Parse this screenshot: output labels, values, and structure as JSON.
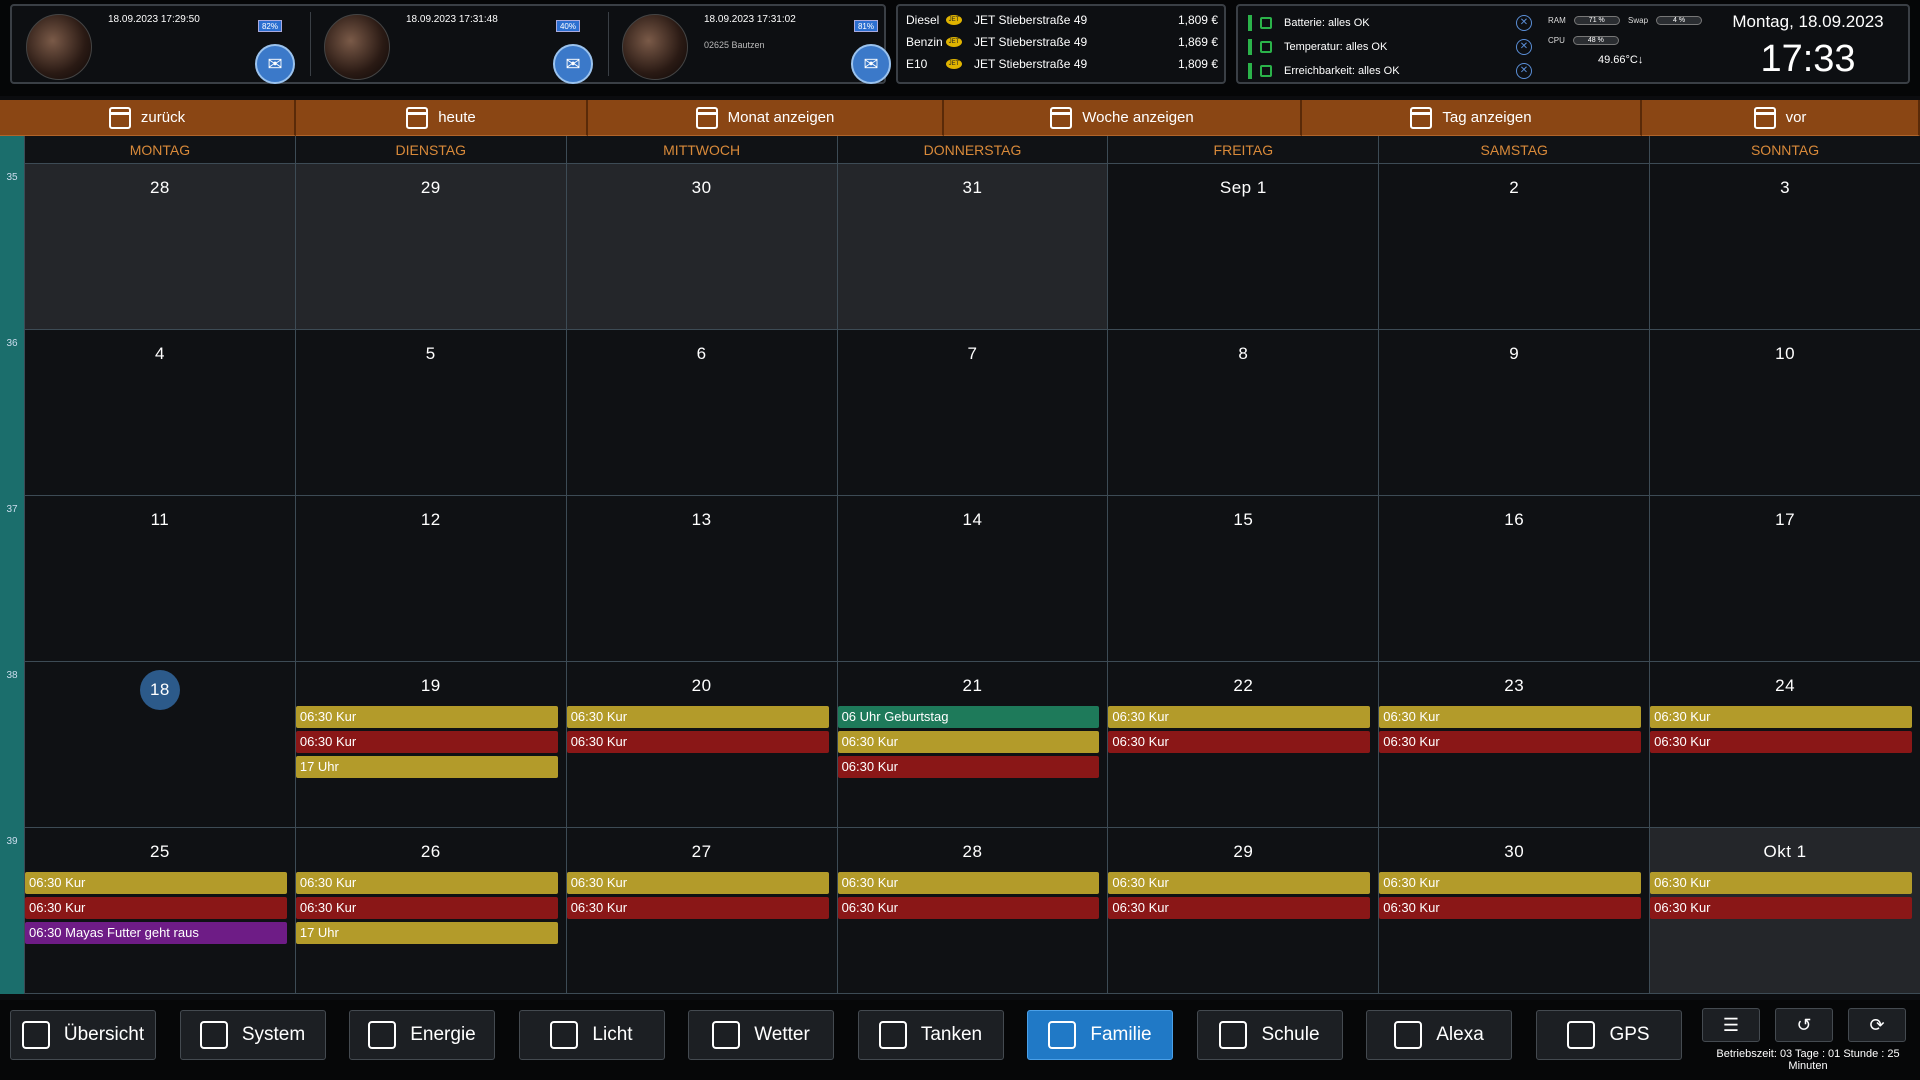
{
  "contacts": [
    {
      "timestamp": "18.09.2023 17:29:50",
      "line1": "",
      "line2": "",
      "battery": "82%"
    },
    {
      "timestamp": "18.09.2023 17:31:48",
      "line1": "",
      "line2": "",
      "battery": "40%"
    },
    {
      "timestamp": "18.09.2023 17:31:02",
      "line1": "",
      "line2": "02625 Bautzen",
      "battery": "81%"
    }
  ],
  "fuel": [
    {
      "type": "Diesel",
      "station": "JET Stieberstraße 49",
      "price": "1,809 €"
    },
    {
      "type": "Benzin",
      "station": "JET Stieberstraße 49",
      "price": "1,869 €"
    },
    {
      "type": "E10",
      "station": "JET Stieberstraße 49",
      "price": "1,809 €"
    }
  ],
  "status": {
    "items": [
      "Batterie: alles OK",
      "Temperatur: alles OK",
      "Erreichbarkeit: alles OK"
    ],
    "ram_label": "RAM",
    "ram_value": "71 %",
    "ram_level": 0.71,
    "swap_label": "Swap",
    "swap_value": "4 %",
    "swap_level": 0.04,
    "cpu_label": "CPU",
    "cpu_value": "48 %",
    "cpu_level": 0.48,
    "temperature": "49.66°C↓",
    "date": "Montag, 18.09.2023",
    "time": "17:33"
  },
  "nav": [
    "zurück",
    "heute",
    "Monat anzeigen",
    "Woche anzeigen",
    "Tag anzeigen",
    "vor"
  ],
  "weekdays": [
    "MONTAG",
    "DIENSTAG",
    "MITTWOCH",
    "DONNERSTAG",
    "FREITAG",
    "SAMSTAG",
    "SONNTAG"
  ],
  "weeks": [
    {
      "no": "35",
      "days": [
        {
          "label": "28",
          "other": true
        },
        {
          "label": "29",
          "other": true
        },
        {
          "label": "30",
          "other": true
        },
        {
          "label": "31",
          "other": true
        },
        {
          "label": "Sep 1"
        },
        {
          "label": "2"
        },
        {
          "label": "3"
        }
      ]
    },
    {
      "no": "36",
      "days": [
        {
          "label": "4"
        },
        {
          "label": "5"
        },
        {
          "label": "6"
        },
        {
          "label": "7"
        },
        {
          "label": "8"
        },
        {
          "label": "9"
        },
        {
          "label": "10"
        }
      ]
    },
    {
      "no": "37",
      "days": [
        {
          "label": "11"
        },
        {
          "label": "12"
        },
        {
          "label": "13"
        },
        {
          "label": "14"
        },
        {
          "label": "15"
        },
        {
          "label": "16"
        },
        {
          "label": "17"
        }
      ]
    },
    {
      "no": "38",
      "days": [
        {
          "label": "18",
          "today": true,
          "events": []
        },
        {
          "label": "19",
          "events": [
            {
              "t": "06:30 Kur",
              "c": "y"
            },
            {
              "t": "06:30 Kur",
              "c": "r"
            },
            {
              "t": "17 Uhr",
              "c": "y"
            }
          ]
        },
        {
          "label": "20",
          "events": [
            {
              "t": "06:30 Kur",
              "c": "y"
            },
            {
              "t": "06:30 Kur",
              "c": "r"
            }
          ]
        },
        {
          "label": "21",
          "events": [
            {
              "t": "06 Uhr Geburtstag",
              "c": "g"
            },
            {
              "t": "06:30 Kur",
              "c": "y"
            },
            {
              "t": "06:30 Kur",
              "c": "r"
            }
          ]
        },
        {
          "label": "22",
          "events": [
            {
              "t": "06:30 Kur",
              "c": "y"
            },
            {
              "t": "06:30 Kur",
              "c": "r"
            }
          ]
        },
        {
          "label": "23",
          "events": [
            {
              "t": "06:30 Kur",
              "c": "y"
            },
            {
              "t": "06:30 Kur",
              "c": "r"
            }
          ]
        },
        {
          "label": "24",
          "events": [
            {
              "t": "06:30 Kur",
              "c": "y"
            },
            {
              "t": "06:30 Kur",
              "c": "r"
            }
          ]
        }
      ]
    },
    {
      "no": "39",
      "days": [
        {
          "label": "25",
          "events": [
            {
              "t": "06:30 Kur",
              "c": "y"
            },
            {
              "t": "06:30 Kur",
              "c": "r"
            },
            {
              "t": "06:30 Mayas Futter geht raus",
              "c": "p"
            }
          ]
        },
        {
          "label": "26",
          "events": [
            {
              "t": "06:30 Kur",
              "c": "y"
            },
            {
              "t": "06:30 Kur",
              "c": "r"
            },
            {
              "t": "17 Uhr",
              "c": "y"
            }
          ]
        },
        {
          "label": "27",
          "events": [
            {
              "t": "06:30 Kur",
              "c": "y"
            },
            {
              "t": "06:30 Kur",
              "c": "r"
            }
          ]
        },
        {
          "label": "28",
          "events": [
            {
              "t": "06:30 Kur",
              "c": "y"
            },
            {
              "t": "06:30 Kur",
              "c": "r"
            }
          ]
        },
        {
          "label": "29",
          "events": [
            {
              "t": "06:30 Kur",
              "c": "y"
            },
            {
              "t": "06:30 Kur",
              "c": "r"
            }
          ]
        },
        {
          "label": "30",
          "events": [
            {
              "t": "06:30 Kur",
              "c": "y"
            },
            {
              "t": "06:30 Kur",
              "c": "r"
            }
          ]
        },
        {
          "label": "Okt 1",
          "other": true,
          "events": [
            {
              "t": "06:30 Kur",
              "c": "y"
            },
            {
              "t": "06:30 Kur",
              "c": "r"
            }
          ]
        }
      ]
    }
  ],
  "bottom_nav": [
    {
      "label": "Übersicht",
      "icon": "home-icon"
    },
    {
      "label": "System",
      "icon": "network-icon"
    },
    {
      "label": "Energie",
      "icon": "energy-icon"
    },
    {
      "label": "Licht",
      "icon": "light-icon"
    },
    {
      "label": "Wetter",
      "icon": "weather-icon"
    },
    {
      "label": "Tanken",
      "icon": "fuel-icon"
    },
    {
      "label": "Familie",
      "icon": "calendar-icon",
      "active": true
    },
    {
      "label": "Schule",
      "icon": "calendar-icon"
    },
    {
      "label": "Alexa",
      "icon": "alexa-icon"
    },
    {
      "label": "GPS",
      "icon": "gps-icon"
    }
  ],
  "uptime": "Betriebszeit: 03 Tage : 01 Stunde : 25 Minuten",
  "colors": {
    "accent": "#2079c6",
    "nav_bg": "#8a4614",
    "event_yellow": "#b39b2a",
    "event_red": "#8a1717",
    "event_green": "#1e7a5a",
    "event_purple": "#6e1c86",
    "week_col": "#1b6e6c",
    "weekday_text": "#d98a3a"
  }
}
